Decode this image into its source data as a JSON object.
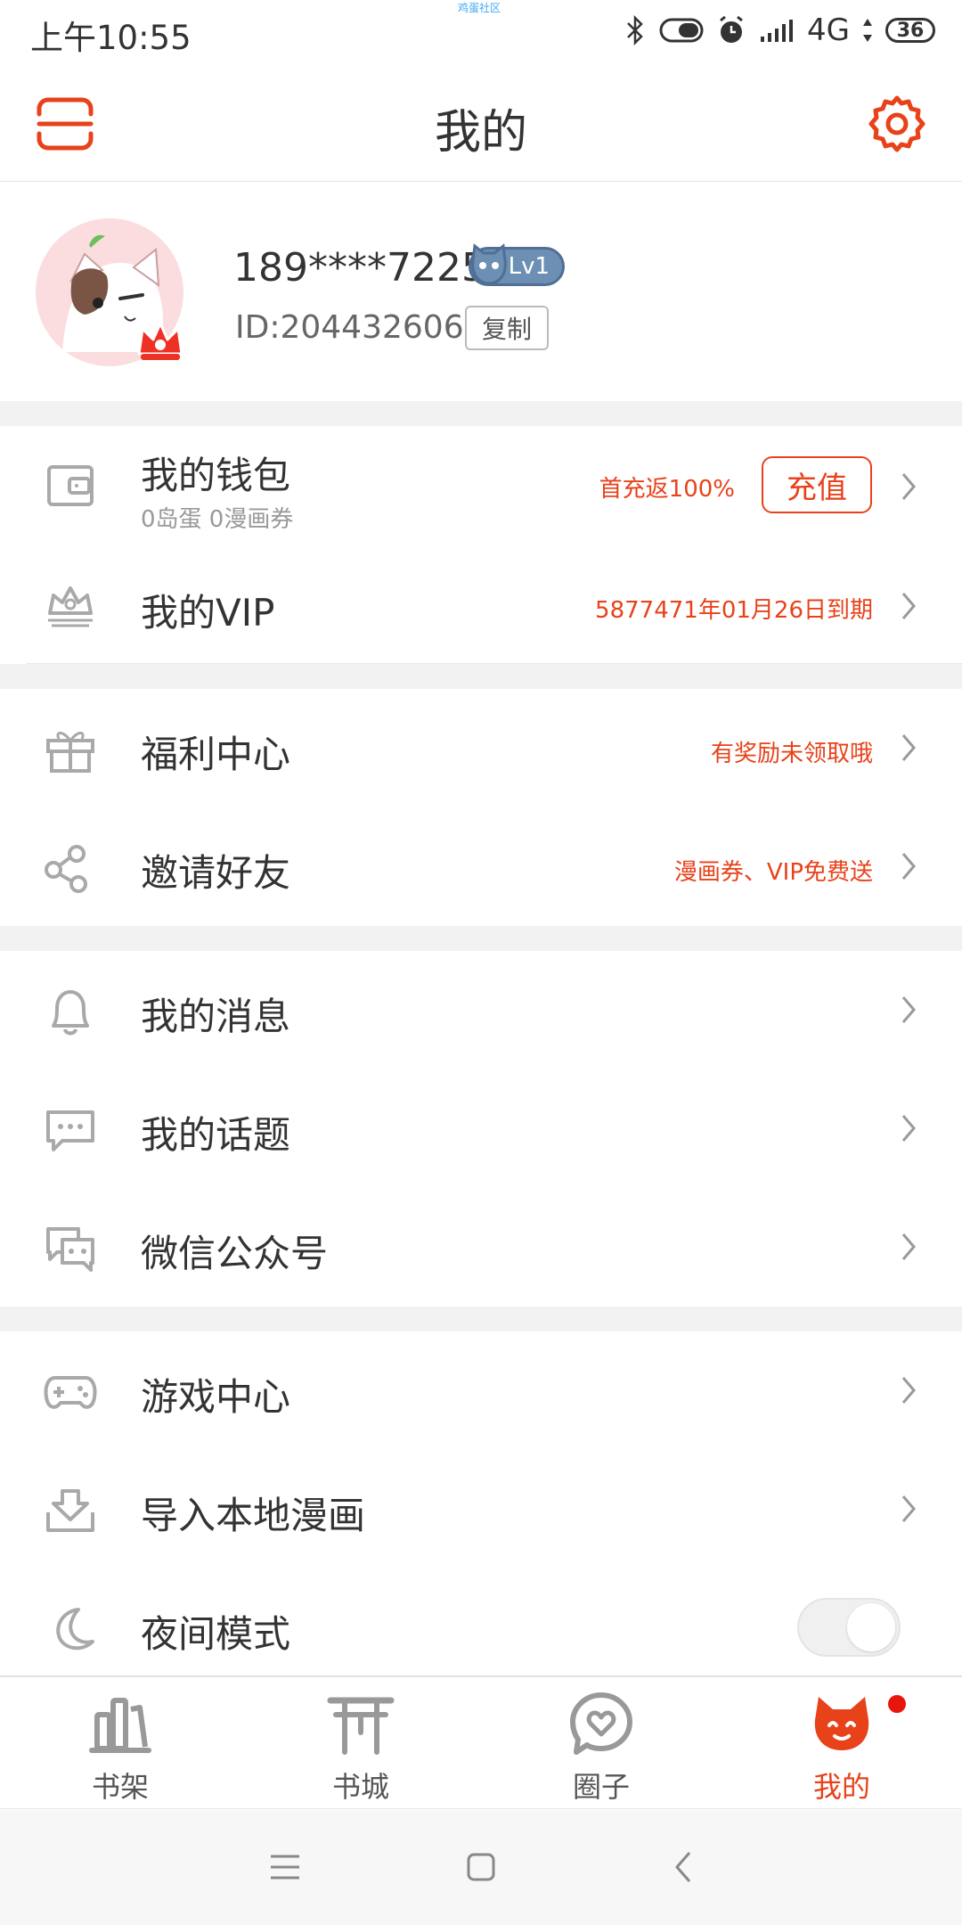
{
  "status_bar": {
    "time": "上午10:55",
    "watermark": "鸡蛋社区",
    "network": "4G",
    "battery": "36"
  },
  "header": {
    "title": "我的"
  },
  "profile": {
    "username": "189****7225",
    "level": "Lv1",
    "user_id": "ID:204432606",
    "copy_label": "复制"
  },
  "menu": {
    "wallet": {
      "label": "我的钱包",
      "sub": "0岛蛋 0漫画券",
      "promo": "首充返100%",
      "charge_label": "充值"
    },
    "vip": {
      "label": "我的VIP",
      "extra": "5877471年01月26日到期"
    },
    "welfare": {
      "label": "福利中心",
      "extra": "有奖励未领取哦"
    },
    "invite": {
      "label": "邀请好友",
      "extra": "漫画券、VIP免费送"
    },
    "messages": {
      "label": "我的消息"
    },
    "topics": {
      "label": "我的话题"
    },
    "wechat": {
      "label": "微信公众号"
    },
    "games": {
      "label": "游戏中心"
    },
    "import": {
      "label": "导入本地漫画"
    },
    "night_mode": {
      "label": "夜间模式",
      "enabled": false
    }
  },
  "bottom_nav": [
    {
      "label": "书架",
      "icon": "bookshelf-icon",
      "active": false
    },
    {
      "label": "书城",
      "icon": "bookstore-icon",
      "active": false
    },
    {
      "label": "圈子",
      "icon": "circle-icon",
      "active": false
    },
    {
      "label": "我的",
      "icon": "cat-icon",
      "active": true
    }
  ],
  "colors": {
    "accent": "#e8421a",
    "text": "#333333",
    "muted": "#999999",
    "separator": "#f2f2f2",
    "level_badge": "#6d8fb3"
  }
}
